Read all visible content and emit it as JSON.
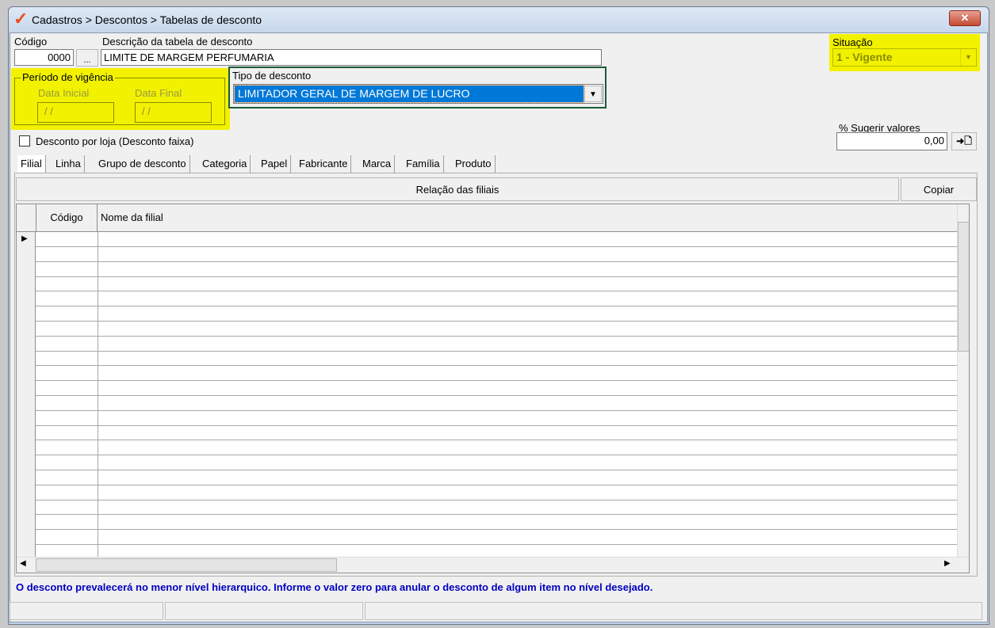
{
  "window": {
    "title": "Cadastros > Descontos > Tabelas de desconto",
    "close_label": "✕"
  },
  "form": {
    "codigo_label": "Código",
    "codigo_value": "0000",
    "lookup_label": "...",
    "descricao_label": "Descrição da tabela de desconto",
    "descricao_value": "LIMITE DE MARGEM PERFUMARIA",
    "situacao_label": "Situação",
    "situacao_value": "1 - Vigente",
    "periodo_label": "Período de vigência",
    "data_inicial_label": "Data Inicial",
    "data_inicial_value": "/ /",
    "data_final_label": "Data Final",
    "data_final_value": "/ /",
    "tipo_label": "Tipo de desconto",
    "tipo_value": "LIMITADOR GERAL DE MARGEM DE LUCRO",
    "desconto_loja_label": "Desconto por loja (Desconto faixa)",
    "sugerir_label": "% Sugerir valores",
    "sugerir_value": "0,00",
    "apply_label": "➜🗋"
  },
  "tabs": [
    {
      "label": "Filial"
    },
    {
      "label": "Linha"
    },
    {
      "label": "Grupo de desconto"
    },
    {
      "label": "Categoria"
    },
    {
      "label": "Papel"
    },
    {
      "label": "Fabricante"
    },
    {
      "label": "Marca"
    },
    {
      "label": "Família"
    },
    {
      "label": "Produto"
    }
  ],
  "panel": {
    "header": "Relação das filiais",
    "copy_label": "Copiar"
  },
  "grid": {
    "columns": [
      "Código",
      "Nome da filial"
    ],
    "row_count": 22
  },
  "footer": {
    "info": "O desconto prevalecerá no menor nível hierarquico. Informe o valor zero para anular o desconto de algum item no nível desejado."
  },
  "colors": {
    "highlight": "#f2f200",
    "selection": "#0078d7",
    "info_text": "#0000c0"
  }
}
